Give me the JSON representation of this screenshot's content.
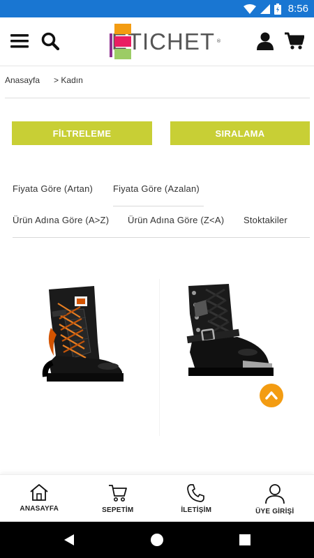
{
  "status_bar": {
    "time": "8:56",
    "bg_color": "#1976d2"
  },
  "header": {
    "logo_text": "ETICHET",
    "logo_reg": "®",
    "icons": [
      "menu-icon",
      "search-icon",
      "user-icon",
      "cart-icon"
    ]
  },
  "breadcrumb": {
    "home": "Anasayfa",
    "current": "> Kadın"
  },
  "actions": {
    "filter_label": "FİLTRELEME",
    "sort_label": "SIRALAMA",
    "accent_color": "#c8cf35"
  },
  "sort_options": [
    "Fiyata Göre (Artan)",
    "Fiyata Göre (Azalan)",
    "Ürün Adına Göre (A>Z)",
    "Ürün Adına Göre (Z<A)",
    "Stoktakiler"
  ],
  "products": [
    {
      "image": "black-biker-boot-orange-laces"
    },
    {
      "image": "black-buckle-boot-metal-toe"
    }
  ],
  "scroll_top_color": "#f39c12",
  "bottom_nav": [
    {
      "label": "ANASAYFA",
      "icon": "home-icon"
    },
    {
      "label": "SEPETİM",
      "icon": "cart-icon"
    },
    {
      "label": "İLETİŞİM",
      "icon": "phone-icon"
    },
    {
      "label": "ÜYE GİRİŞİ",
      "icon": "user-icon"
    }
  ]
}
